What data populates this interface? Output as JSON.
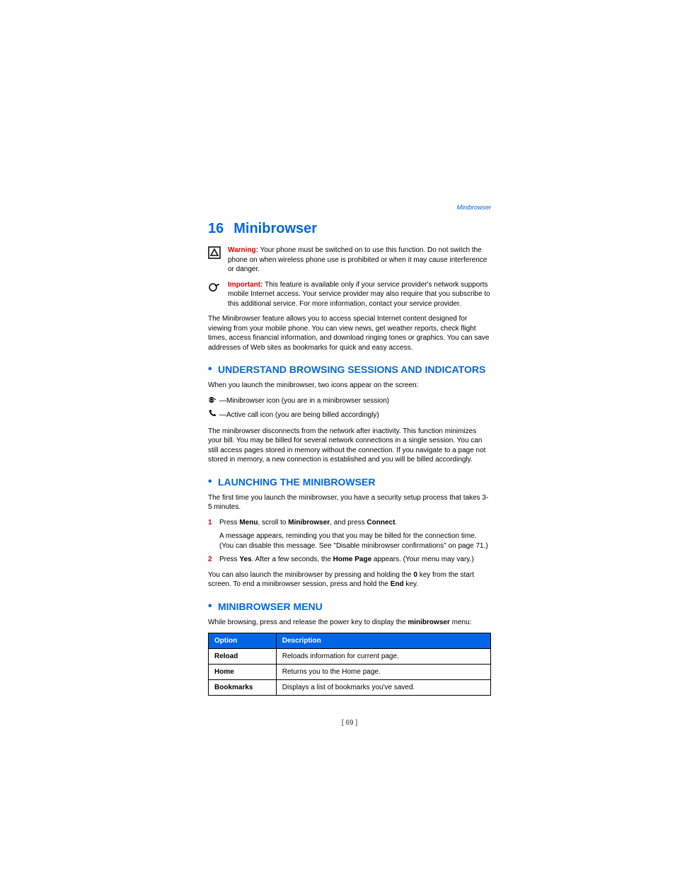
{
  "header_link": "Minibrowser",
  "chapter": {
    "number": "16",
    "title": "Minibrowser"
  },
  "warning": {
    "label": "Warning:",
    "text": " Your phone must be switched on to use this function. Do not switch the phone on when wireless phone use is prohibited or when it may cause interference or danger."
  },
  "important": {
    "label": "Important:",
    "text": " This feature is available only if your service provider's network supports mobile Internet access. Your service provider may also require that you subscribe to this additional service. For more information, contact your service provider."
  },
  "intro": "The Minibrowser feature allows you to access special Internet content designed for viewing from your mobile phone. You can view news, get weather reports, check flight times, access financial information, and download ringing tones or graphics. You can save addresses of Web sites as bookmarks for quick and easy access.",
  "section1": {
    "heading": "UNDERSTAND BROWSING SESSIONS AND INDICATORS",
    "p1": "When you launch the minibrowser, two icons appear on the screen:",
    "icon1": "—Minibrowser icon (you are in a minibrowser session)",
    "icon2": "—Active call icon (you are being billed accordingly)",
    "p2": "The minibrowser disconnects from the network after inactivity. This function minimizes your bill. You may be billed for several network connections in a single session. You can still access pages stored in memory without the connection. If you navigate to a page not stored in memory, a new connection is established and you will be billed accordingly."
  },
  "section2": {
    "heading": "LAUNCHING THE MINIBROWSER",
    "p1": "The first time you launch the minibrowser, you have a security setup process that takes 3-5 minutes.",
    "step1": {
      "n": "1",
      "pre": "Press ",
      "b1": "Menu",
      "mid1": ", scroll to ",
      "b2": "Minibrowser",
      "mid2": ", and press ",
      "b3": "Connect",
      "post": "."
    },
    "step1sub": "A message appears, reminding you that you may be billed for the connection time. (You can disable this message. See \"Disable minibrowser confirmations\" on page 71.)",
    "step2": {
      "n": "2",
      "pre": "Press ",
      "b1": "Yes",
      "mid1": ". After a few seconds, the ",
      "b2": "Home Page",
      "post": " appears. (Your menu may vary.)"
    },
    "p2a": "You can also launch the minibrowser by pressing and holding the ",
    "p2b": "0",
    "p2c": " key from the start screen. To end a minibrowser session, press and hold the ",
    "p2d": "End",
    "p2e": " key."
  },
  "section3": {
    "heading": "MINIBROWSER MENU",
    "p1a": "While browsing, press and release the power key to display the ",
    "p1b": "minibrowser",
    "p1c": " menu:",
    "table": {
      "h1": "Option",
      "h2": "Description",
      "rows": [
        {
          "opt": "Reload",
          "desc": "Reloads information for current page."
        },
        {
          "opt": "Home",
          "desc": "Returns you to the Home page."
        },
        {
          "opt": "Bookmarks",
          "desc": "Displays a list of bookmarks you've saved."
        }
      ]
    }
  },
  "footer": "[ 69 ]"
}
